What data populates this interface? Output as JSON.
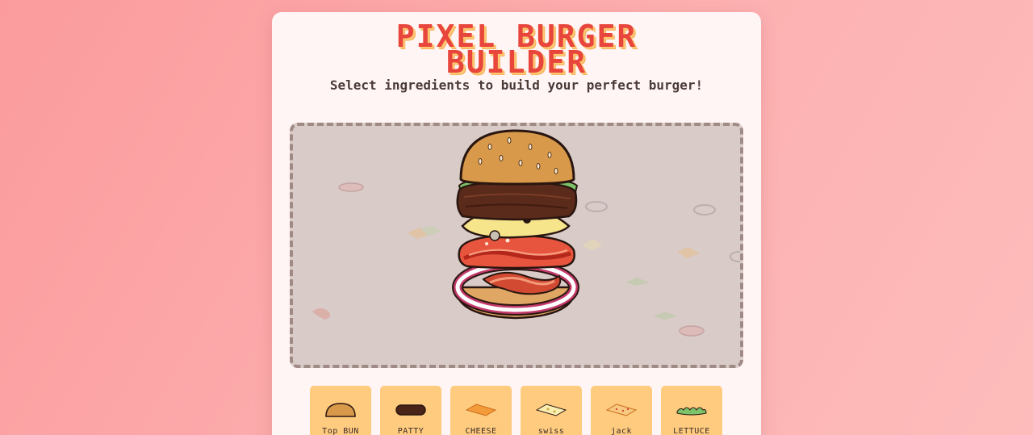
{
  "header": {
    "title_line1": "PIXEL BURGER",
    "title_line2": "BUILDER",
    "subtitle": "Select ingredients to build your perfect burger!"
  },
  "stack": [
    "top-bun",
    "lettuce",
    "patty",
    "cheese",
    "tomato",
    "bacon",
    "onion",
    "bottom-bun"
  ],
  "ingredients": [
    {
      "label": "Top BUN",
      "icon": "bun-icon"
    },
    {
      "label": "PATTY",
      "icon": "patty-icon"
    },
    {
      "label": "CHEESE",
      "icon": "cheese-icon"
    },
    {
      "label": "swiss",
      "icon": "swiss-icon"
    },
    {
      "label": "jack",
      "icon": "jack-icon"
    },
    {
      "label": "LETTUCE",
      "icon": "lettuce-icon"
    }
  ],
  "colors": {
    "title": "#e8453c",
    "button": "#ffcb7f",
    "stage": "#d8cbc8",
    "bun": "#d89a4a",
    "patty": "#5a2a1a",
    "cheese": "#f7e58c",
    "tomato": "#e8553e",
    "lettuce": "#7cc36a",
    "onion": "#c23a6a"
  }
}
